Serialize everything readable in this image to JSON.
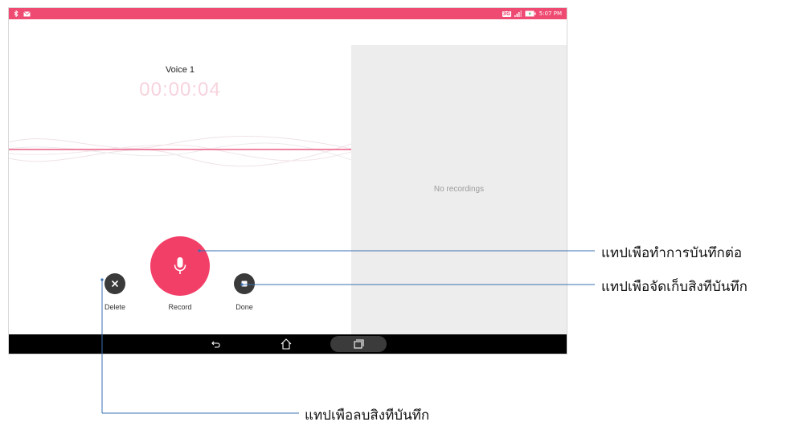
{
  "status_bar": {
    "left_icons": [
      "bluetooth-icon",
      "mail-icon"
    ],
    "network_badge": "3G",
    "time": "5:07 PM",
    "accent_color": "#ef4a72"
  },
  "recorder": {
    "recording_name": "Voice 1",
    "elapsed_time": "00:00:04",
    "empty_list_text": "No recordings",
    "controls": {
      "delete_label": "Delete",
      "record_label": "Record",
      "done_label": "Done"
    }
  },
  "nav_bar": {
    "icons": [
      "back-icon",
      "home-icon",
      "recent-apps-icon"
    ]
  },
  "callouts": {
    "record": "แทปเพือทำการบันทึกต่อ",
    "done": "แทปเพือจัดเก็บสิงทีบันทึก",
    "delete": "แทปเพือลบสิงทีบันทึก"
  }
}
